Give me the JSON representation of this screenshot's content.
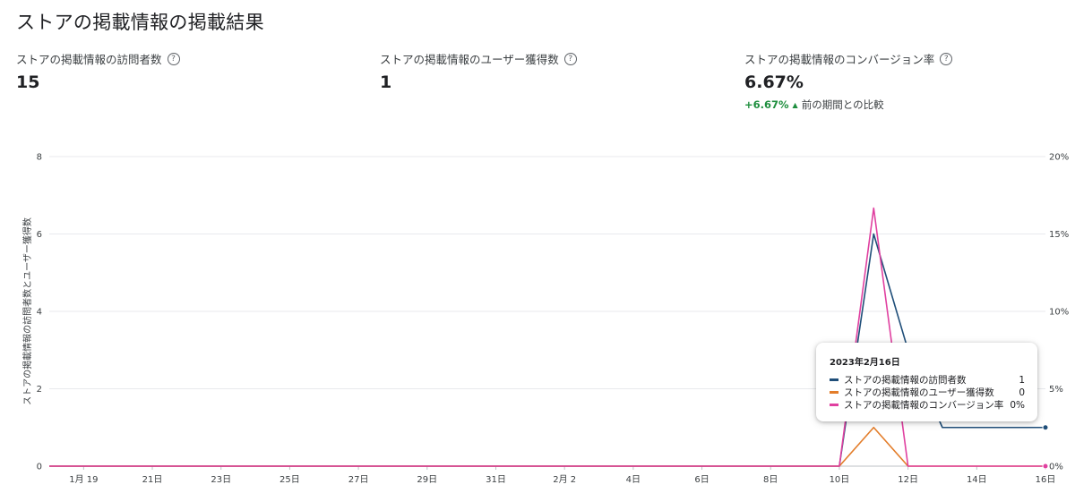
{
  "page": {
    "title": "ストアの掲載情報の掲載結果"
  },
  "metrics": [
    {
      "label": "ストアの掲載情報の訪問者数",
      "value": "15"
    },
    {
      "label": "ストアの掲載情報のユーザー獲得数",
      "value": "1"
    },
    {
      "label": "ストアの掲載情報のコンバージョン率",
      "value": "6.67%",
      "delta": "+6.67%",
      "compare": "前の期間との比較"
    }
  ],
  "icons": {
    "help": "help-circle-icon",
    "trend": "arrow-up-icon"
  },
  "help_glyph": "?",
  "trend_glyph": "▲",
  "colors": {
    "visitors": "#1f4e79",
    "acquisitions": "#e37d2a",
    "conversion": "#e040a0",
    "positive": "#1e8e3e"
  },
  "tooltip": {
    "date": "2023年2月16日",
    "rows": [
      {
        "name": "ストアの掲載情報の訪問者数",
        "value": "1"
      },
      {
        "name": "ストアの掲載情報のユーザー獲得数",
        "value": "0"
      },
      {
        "name": "ストアの掲載情報のコンバージョン率",
        "value": "0%"
      }
    ]
  },
  "chart_data": {
    "type": "line",
    "title": "",
    "ylabel": "ストアの掲載情報の訪問者数とユーザー獲得数",
    "ylim": [
      0,
      8
    ],
    "y_ticks": [
      "0",
      "2",
      "4",
      "6",
      "8"
    ],
    "y2lim": [
      0,
      20
    ],
    "y2_ticks": [
      "0%",
      "5%",
      "10%",
      "15%",
      "20%"
    ],
    "grid": true,
    "x_dates": [
      "1/18",
      "1/19",
      "1/20",
      "1/21",
      "1/22",
      "1/23",
      "1/24",
      "1/25",
      "1/26",
      "1/27",
      "1/28",
      "1/29",
      "1/30",
      "1/31",
      "2/1",
      "2/2",
      "2/3",
      "2/4",
      "2/5",
      "2/6",
      "2/7",
      "2/8",
      "2/9",
      "2/10",
      "2/11",
      "2/12",
      "2/13",
      "2/14",
      "2/15",
      "2/16"
    ],
    "x_tick_labels": [
      "1月 19",
      "21日",
      "23日",
      "25日",
      "27日",
      "29日",
      "31日",
      "2月 2",
      "4日",
      "6日",
      "8日",
      "10日",
      "12日",
      "14日",
      "16日"
    ],
    "series": [
      {
        "name": "ストアの掲載情報の訪問者数",
        "axis": "left",
        "values": [
          0,
          0,
          0,
          0,
          0,
          0,
          0,
          0,
          0,
          0,
          0,
          0,
          0,
          0,
          0,
          0,
          0,
          0,
          0,
          0,
          0,
          0,
          0,
          0,
          6,
          3,
          1,
          1,
          1,
          1
        ]
      },
      {
        "name": "ストアの掲載情報のユーザー獲得数",
        "axis": "left",
        "values": [
          0,
          0,
          0,
          0,
          0,
          0,
          0,
          0,
          0,
          0,
          0,
          0,
          0,
          0,
          0,
          0,
          0,
          0,
          0,
          0,
          0,
          0,
          0,
          0,
          1,
          0,
          0,
          0,
          0,
          0
        ]
      },
      {
        "name": "ストアの掲載情報のコンバージョン率",
        "axis": "right",
        "values": [
          0,
          0,
          0,
          0,
          0,
          0,
          0,
          0,
          0,
          0,
          0,
          0,
          0,
          0,
          0,
          0,
          0,
          0,
          0,
          0,
          0,
          0,
          0,
          0,
          16.67,
          0,
          0,
          0,
          0,
          0
        ]
      }
    ]
  }
}
